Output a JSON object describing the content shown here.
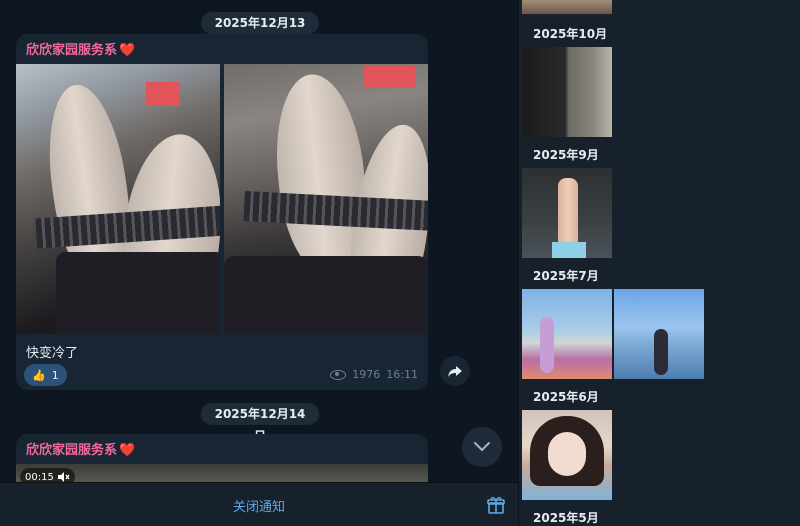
{
  "chat": {
    "date_1": "2025年12月13日",
    "date_2": "2025年12月14日",
    "post_1": {
      "sender": "欣欣家园服务系",
      "sender_emoji": "❤️",
      "caption": "快变冷了",
      "reaction_emoji": "👍",
      "reaction_count": "1",
      "views": "1976",
      "time": "16:11"
    },
    "post_2": {
      "sender": "欣欣家园服务系",
      "sender_emoji": "❤️",
      "video_duration": "00:15"
    },
    "footer_label": "关闭通知"
  },
  "media_sidebar": {
    "months": [
      "2025年10月",
      "2025年9月",
      "2025年7月",
      "2025年6月",
      "2025年5月"
    ]
  },
  "colors": {
    "background": "#0e1621",
    "bubble": "#182533",
    "sender_name": "#f06a9b",
    "link": "#5fa8e6",
    "reaction_bg": "#2b5278"
  },
  "icons": [
    "share-icon",
    "chevron-down-icon",
    "eye-icon",
    "mute-icon",
    "gift-icon"
  ]
}
